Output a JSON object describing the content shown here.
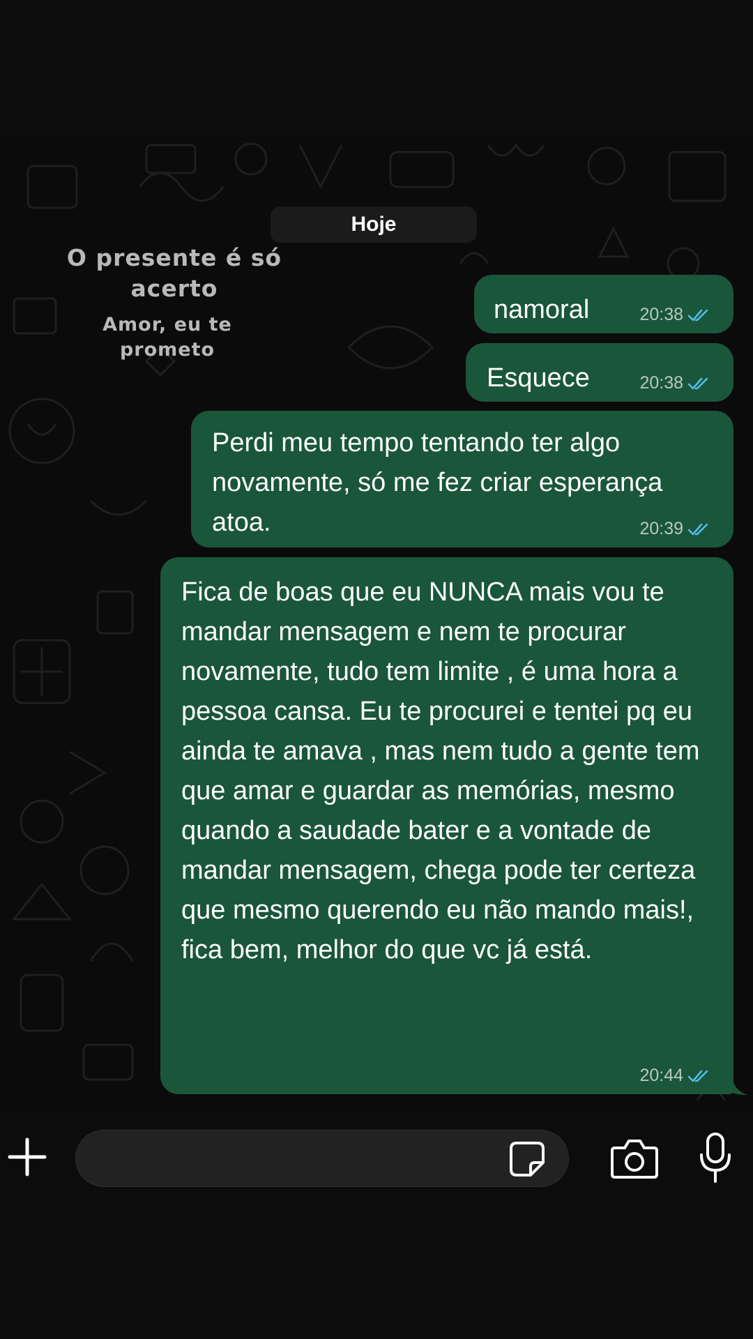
{
  "chat": {
    "date_label": "Hoje",
    "overlay_sticker": {
      "line1": "O presente é só acerto",
      "line2": "Amor, eu te prometo"
    },
    "messages": [
      {
        "text": "namoral",
        "time": "20:38",
        "status": "read"
      },
      {
        "text": "Esquece",
        "time": "20:38",
        "status": "read"
      },
      {
        "text": "Perdi meu tempo tentando ter algo novamente, só me fez criar esperança atoa.",
        "time": "20:39",
        "status": "read"
      },
      {
        "text": "Fica de boas que eu NUNCA mais vou te mandar mensagem e nem te procurar novamente, tudo tem limite , é uma hora a pessoa cansa. Eu te procurei e tentei pq eu ainda te amava , mas nem tudo a gente tem que amar e guardar as memórias, mesmo quando a saudade bater e a vontade de mandar mensagem, chega pode ter certeza que mesmo querendo eu não mando mais!, fica bem, melhor do que vc já está.",
        "time": "20:44",
        "status": "read"
      }
    ]
  },
  "input_bar": {
    "plus_icon": "plus-icon",
    "sticker_icon": "sticker-icon",
    "camera_icon": "camera-icon",
    "mic_icon": "microphone-icon"
  },
  "colors": {
    "outgoing_bubble": "#1a563a",
    "read_ticks": "#53bdeb",
    "background": "#0b0b0b"
  }
}
